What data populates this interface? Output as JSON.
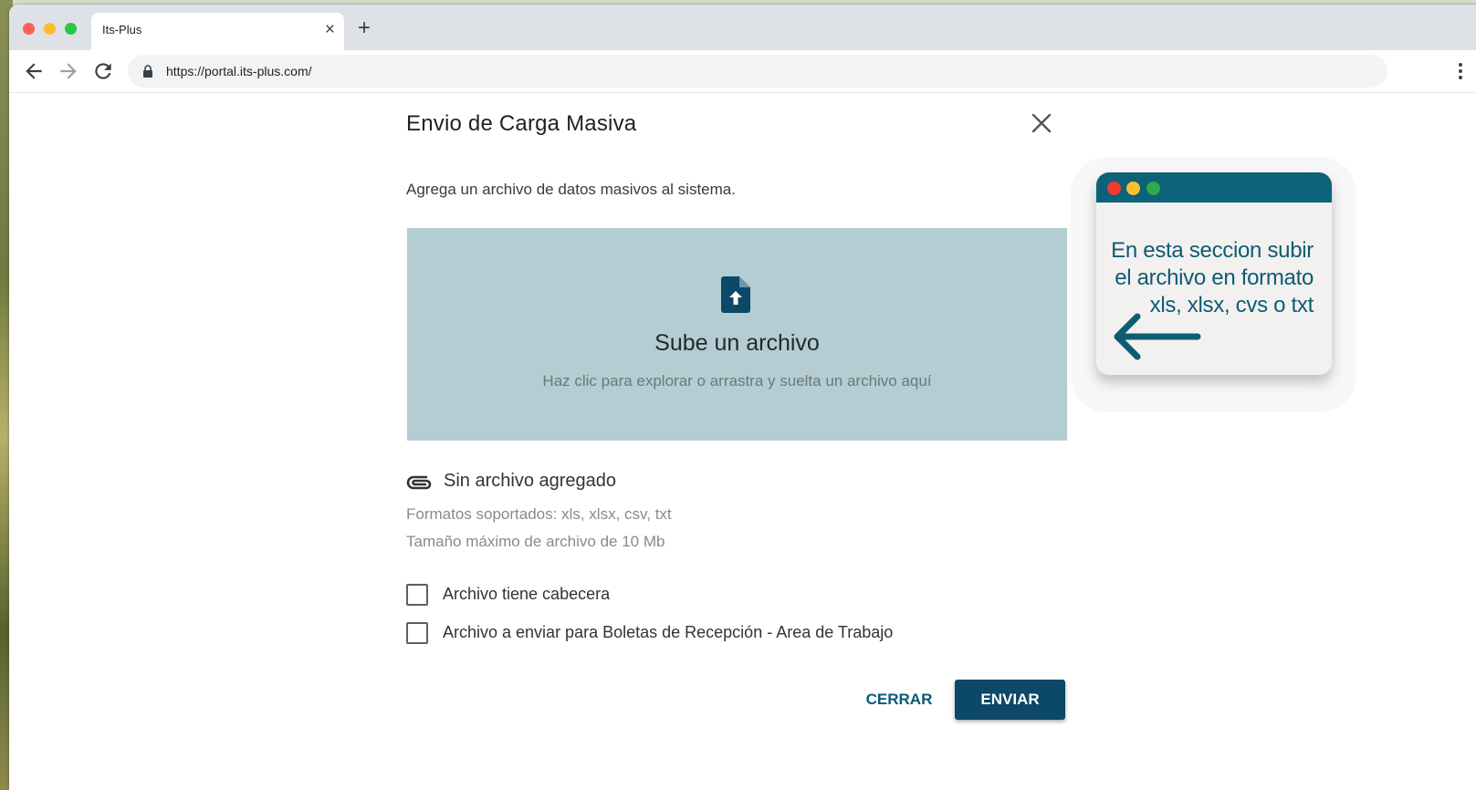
{
  "browser": {
    "tab_title": "Its-Plus",
    "tab_close": "×",
    "new_tab": "+",
    "url": "https://portal.its-plus.com/"
  },
  "dialog": {
    "title": "Envio de Carga Masiva",
    "subtitle": "Agrega un archivo de datos masivos al sistema.",
    "dropzone": {
      "icon": "file-upload-icon",
      "title": "Sube un archivo",
      "hint": "Haz clic para explorar o arrastra y suelta un archivo aquí"
    },
    "file_status": "Sin archivo agregado",
    "formats": "Formatos soportados: xls, xlsx, csv, txt",
    "max_size": "Tamaño máximo de archivo de 10 Mb",
    "checkboxes": [
      {
        "label": "Archivo tiene cabecera",
        "checked": false
      },
      {
        "label": "Archivo a enviar para Boletas de Recepción - Area de Trabajo",
        "checked": false
      }
    ],
    "buttons": {
      "close": "CERRAR",
      "send": "ENVIAR"
    }
  },
  "callout": {
    "lines": [
      "En esta seccion subir",
      "el archivo en formato",
      "xls, xlsx, cvs o txt"
    ]
  },
  "colors": {
    "primary": "#0c4867",
    "accent_text": "#0a5a78",
    "dropzone_bg": "#b4cdd2",
    "callout_bar": "#0c6278"
  }
}
